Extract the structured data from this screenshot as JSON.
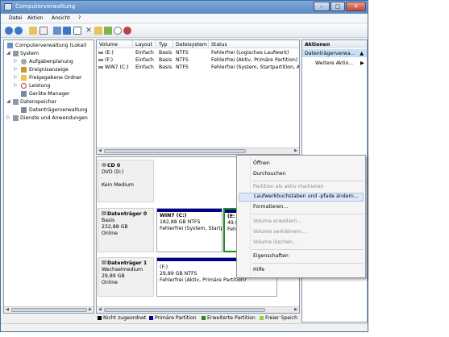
{
  "window": {
    "title": "Computerverwaltung",
    "controls": [
      "–",
      "□",
      "✕"
    ]
  },
  "menu": [
    "Datei",
    "Aktion",
    "Ansicht",
    "?"
  ],
  "toolbar": {
    "icons": [
      "back-arrow-icon",
      "forward-arrow-icon",
      "up-folder-icon",
      "show-tree-icon",
      "properties-icon",
      "help-icon",
      "help-book-icon",
      "delete-icon",
      "open-folder-icon",
      "check-icon",
      "search-icon",
      "manage-icon"
    ]
  },
  "tree": {
    "items": [
      {
        "label": "Computerverwaltung (Lokal)",
        "expander": ""
      },
      {
        "label": "System",
        "expander": "◢"
      },
      {
        "label": "Aufgabenplanung",
        "expander": "▷"
      },
      {
        "label": "Ereignisanzeige",
        "expander": "▷"
      },
      {
        "label": "Freigegebene Ordner",
        "expander": "▷"
      },
      {
        "label": "Leistung",
        "expander": "▷"
      },
      {
        "label": "Geräte-Manager",
        "expander": ""
      },
      {
        "label": "Datenspeicher",
        "expander": "◢"
      },
      {
        "label": "Datenträgerverwaltung",
        "expander": ""
      },
      {
        "label": "Dienste und Anwendungen",
        "expander": "▷"
      }
    ]
  },
  "volumes": {
    "columns": [
      "Volume",
      "Layout",
      "Typ",
      "Dateisystem",
      "Status"
    ],
    "rows": [
      [
        "(E:)",
        "Einfach",
        "Basis",
        "NTFS",
        "Fehlerfrei (Logisches Laufwerk)"
      ],
      [
        "(F:)",
        "Einfach",
        "Basis",
        "NTFS",
        "Fehlerfrei (Aktiv, Primäre Partition)"
      ],
      [
        "WIN7 (C:)",
        "Einfach",
        "Basis",
        "NTFS",
        "Fehlerfrei (System, Startpartition, Ak"
      ]
    ]
  },
  "disks": [
    {
      "name": "CD 0",
      "type": "DVD (D:)",
      "size": "",
      "status": "Kein Medium",
      "partitions": []
    },
    {
      "name": "Datenträger 0",
      "type": "Basis",
      "size": "232,88 GB",
      "status": "Online",
      "partitions": [
        {
          "name": "WIN7  (C:)",
          "size": "182,88 GB NTFS",
          "status": "Fehlerfrei (System, Startp",
          "color": "#00008b"
        },
        {
          "name": "(E:",
          "size": "49,9",
          "status": "Fehl",
          "color": "#228b22"
        }
      ]
    },
    {
      "name": "Datenträger 1",
      "type": "Wechselmedium",
      "size": "29,89 GB",
      "status": "Online",
      "partitions": [
        {
          "name": "(F:)",
          "size": "29,89 GB NTFS",
          "status": "Fehlerfrei (Aktiv, Primäre Partition)",
          "color": "#00008b"
        }
      ]
    }
  ],
  "legend": [
    {
      "label": "Nicht zugeordnet",
      "color": "#000000"
    },
    {
      "label": "Primäre Partition",
      "color": "#00008b"
    },
    {
      "label": "Erweiterte Partition",
      "color": "#228b22"
    },
    {
      "label": "Freier Speich",
      "color": "#8fd14f"
    }
  ],
  "actions": {
    "header": "Aktionen",
    "selected": "Datenträgerverwa...",
    "more": "Weitere Aktio..."
  },
  "context_menu": {
    "items": [
      {
        "label": "Öffnen",
        "state": "enabled"
      },
      {
        "label": "Durchsuchen",
        "state": "enabled"
      },
      {
        "label": "Partition als aktiv markieren",
        "state": "disabled"
      },
      {
        "label": "Laufwerkbuchstaben und -pfade ändern...",
        "state": "highlighted"
      },
      {
        "label": "Formatieren...",
        "state": "enabled"
      },
      {
        "label": "Volume erweitern...",
        "state": "disabled"
      },
      {
        "label": "Volume verkleinern...",
        "state": "disabled"
      },
      {
        "label": "Volume löschen...",
        "state": "disabled"
      },
      {
        "label": "Eigenschaften",
        "state": "enabled"
      },
      {
        "label": "Hilfe",
        "state": "enabled"
      }
    ]
  },
  "colors": {
    "primary_partition": "#00008b",
    "extended_partition": "#228b22",
    "free_space": "#8fd14f",
    "unallocated": "#000000",
    "selection": "#c9def5"
  }
}
